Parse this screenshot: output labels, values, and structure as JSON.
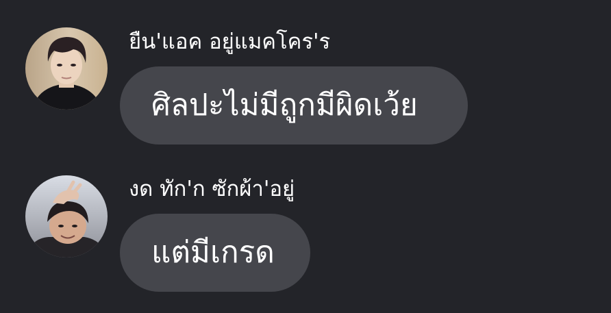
{
  "messages": [
    {
      "sender": "ยืน'แอค อยู่แมคโคร'ร",
      "text": "ศิลปะไม่มีถูกมีผิดเว้ย",
      "avatar_icon": "user-photo-icon"
    },
    {
      "sender": "งด ทัก'ก ซักผ้า'อยู่",
      "text": "แต่มีเกรด",
      "avatar_icon": "user-photo-icon"
    }
  ],
  "colors": {
    "background": "#232429",
    "bubble": "#45464c",
    "text": "#ffffff"
  }
}
